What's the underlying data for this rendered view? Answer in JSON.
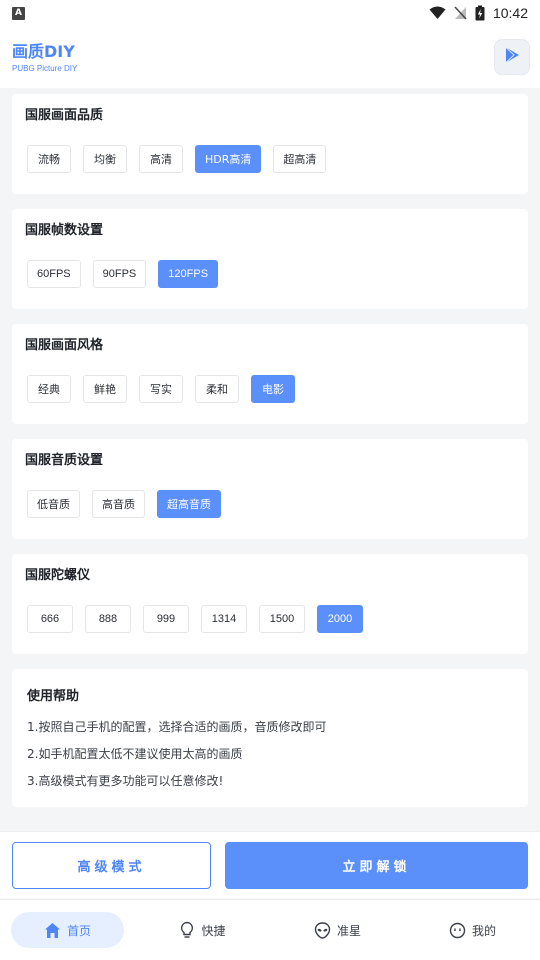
{
  "status_bar": {
    "app_icon_letter": "A",
    "time": "10:42"
  },
  "header": {
    "title": "画质DIY",
    "subtitle": "PUBG Picture DIY"
  },
  "sections": [
    {
      "title": "国服画面品质",
      "options": [
        "流畅",
        "均衡",
        "高清",
        "HDR高清",
        "超高清"
      ],
      "selected": "HDR高清"
    },
    {
      "title": "国服帧数设置",
      "options": [
        "60FPS",
        "90FPS",
        "120FPS"
      ],
      "selected": "120FPS"
    },
    {
      "title": "国服画面风格",
      "options": [
        "经典",
        "鲜艳",
        "写实",
        "柔和",
        "电影"
      ],
      "selected": "电影"
    },
    {
      "title": "国服音质设置",
      "options": [
        "低音质",
        "高音质",
        "超高音质"
      ],
      "selected": "超高音质"
    },
    {
      "title": "国服陀螺仪",
      "options": [
        "666",
        "888",
        "999",
        "1314",
        "1500",
        "2000"
      ],
      "selected": "2000"
    }
  ],
  "help": {
    "title": "使用帮助",
    "lines": [
      "1.按照自己手机的配置，选择合适的画质，音质修改即可",
      "2.如手机配置太低不建议使用太高的画质",
      "3.高级模式有更多功能可以任意修改!"
    ]
  },
  "actions": {
    "advanced_label": "高级模式",
    "unlock_label": "立即解锁"
  },
  "nav": {
    "items": [
      {
        "label": "首页",
        "icon": "home-icon",
        "active": true
      },
      {
        "label": "快捷",
        "icon": "lightbulb-icon",
        "active": false
      },
      {
        "label": "准星",
        "icon": "alien-icon",
        "active": false
      },
      {
        "label": "我的",
        "icon": "face-icon",
        "active": false
      }
    ]
  },
  "colors": {
    "accent": "#5b8ff9",
    "brand_text": "#4f86f7",
    "background": "#f4f5f7"
  }
}
